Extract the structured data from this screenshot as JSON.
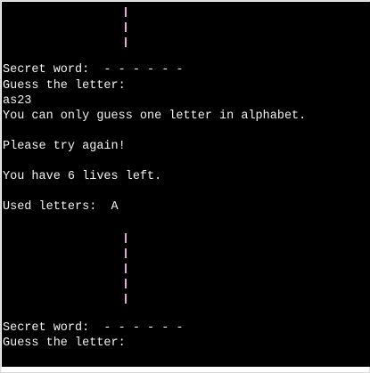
{
  "colors": {
    "terminal_bg": "#000000",
    "terminal_text": "#f2f2f2",
    "gallows_pole": "#e5a7d6",
    "window_border": "#d9d9d9"
  },
  "terminal": {
    "lines": [
      {
        "key": "secret_word_1",
        "text": "Secret word:  - - - - - -"
      },
      {
        "key": "guess_prompt_1",
        "text": "Guess the letter:"
      },
      {
        "key": "user_input_1",
        "text": "as23"
      },
      {
        "key": "error_1",
        "text": "You can only guess one letter in alphabet."
      },
      {
        "key": "retry_1",
        "text": "Please try again!"
      },
      {
        "key": "lives_1",
        "text": "You have 6 lives left."
      },
      {
        "key": "used_letters_1",
        "text": "Used letters:  A"
      },
      {
        "key": "secret_word_2",
        "text": "Secret word:  - - - - - -"
      },
      {
        "key": "guess_prompt_2",
        "text": "Guess the letter:"
      }
    ]
  }
}
